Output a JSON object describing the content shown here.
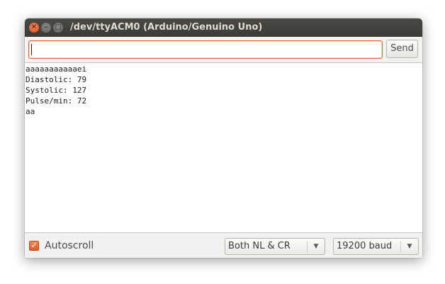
{
  "window": {
    "title": "/dev/ttyACM0 (Arduino/Genuino Uno)",
    "controls": {
      "close_glyph": "✕",
      "minimize_glyph": "–",
      "maximize_glyph": "□"
    }
  },
  "send_bar": {
    "input_value": "",
    "send_label": "Send"
  },
  "console": {
    "lines": [
      "aaaaaaaaaaaei",
      "Diastolic: 79",
      "Systolic: 127",
      "Pulse/min: 72",
      "aa"
    ]
  },
  "status_bar": {
    "autoscroll_label": "Autoscroll",
    "autoscroll_checked": true,
    "checkbox_glyph": "✓",
    "line_ending_selected": "Both NL & CR",
    "baud_rate_selected": "19200 baud",
    "dropdown_glyph": "▼"
  },
  "colors": {
    "accent": "#e0663a",
    "titlebar": "#3c3b37",
    "title_text": "#dfdbd2"
  },
  "icons": {
    "close": "close-icon",
    "minimize": "minimize-icon",
    "maximize": "maximize-icon",
    "checkbox": "checkmark-icon",
    "dropdown": "chevron-down-icon"
  }
}
